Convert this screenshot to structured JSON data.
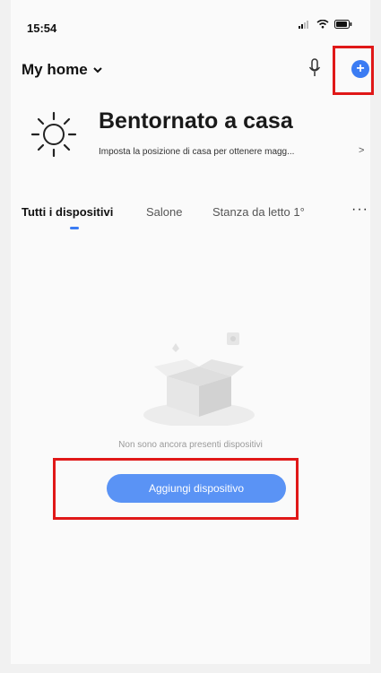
{
  "status_bar": {
    "time": "15:54"
  },
  "header": {
    "home_name": "My home"
  },
  "welcome": {
    "title": "Bentornato a casa",
    "subtitle": "Imposta la posizione di casa per ottenere magg...",
    "chevron": ">"
  },
  "tabs": [
    {
      "label": "Tutti i dispositivi",
      "active": true
    },
    {
      "label": "Salone",
      "active": false
    },
    {
      "label": "Stanza da letto 1°",
      "active": false
    }
  ],
  "more_label": "···",
  "empty_state": {
    "message": "Non sono ancora presenti dispositivi",
    "button_label": "Aggiungi dispositivo"
  },
  "icons": {
    "add": "plus-circle-icon",
    "mic": "microphone-icon",
    "weather": "sun-icon",
    "empty": "empty-box-icon",
    "dropdown": "chevron-down-icon"
  },
  "colors": {
    "accent": "#3b7cf3",
    "button": "#5a93f5",
    "highlight": "#e01818"
  }
}
